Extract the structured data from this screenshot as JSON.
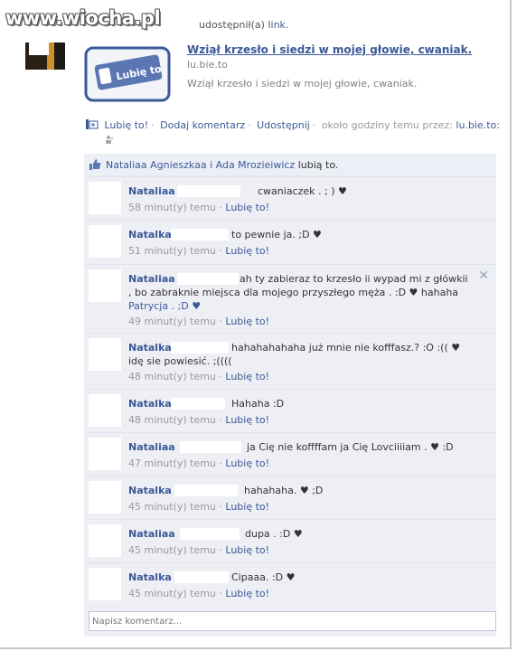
{
  "watermark": "www.wiocha.pl",
  "post": {
    "shared_text": "udostępnił(a)",
    "shared_link": "link.",
    "link_title": "Wziął krzesło i siedzi w mojej głowie, cwaniak.",
    "link_domain": "lu.bie.to",
    "link_description": "Wziął krzesło i siedzi w mojej głowie, cwaniak.",
    "thumb_text": "Lubię to"
  },
  "actions": {
    "like": "Lubię to!",
    "comment": "Dodaj komentarz",
    "share": "Udostępnij",
    "time": "około godziny temu przez:",
    "via": "lu.bie.to:"
  },
  "likes": {
    "names": "Nataliaa Agnieszkaa i Ada Mrozieiwicz",
    "suffix": "lubią to."
  },
  "comments": [
    {
      "author": "Nataliaa",
      "text": "cwaniaczek . ; ) ♥",
      "time": "58 minut(y) temu",
      "like": "Lubię to!"
    },
    {
      "author": "Natalka",
      "text": "to pewnie ja. ;D ♥",
      "time": "51 minut(y) temu",
      "like": "Lubię to!"
    },
    {
      "author": "Nataliaa",
      "text": "ah ty zabieraz to krzesło ii wypad mi z główkii",
      "text2": ", bo zabraknie miejsca dla mojego przyszłego męża . :D ♥ hahaha",
      "text3": "Patrycja . ;D ♥",
      "time": "49 minut(y) temu",
      "like": "Lubię to!"
    },
    {
      "author": "Natalka",
      "text": "hahahahahaha już mnie nie kofffasz.? :O :(( ♥",
      "text2": "idę sie powiesić. ;((((",
      "time": "48 minut(y) temu",
      "like": "Lubię to!"
    },
    {
      "author": "Natalka",
      "text": "Hahaha :D",
      "time": "48 minut(y) temu",
      "like": "Lubię to!"
    },
    {
      "author": "Nataliaa",
      "text": "ja Cię nie koffffam ja Cię Lovciiiiam . ♥ :D",
      "time": "47 minut(y) temu",
      "like": "Lubię to!"
    },
    {
      "author": "Natalka",
      "text": "hahahaha. ♥ ;D",
      "time": "45 minut(y) temu",
      "like": "Lubię to!"
    },
    {
      "author": "Nataliaa",
      "text": "dupa . :D ♥",
      "time": "45 minut(y) temu",
      "like": "Lubię to!"
    },
    {
      "author": "Natalka",
      "text": "Cipaaa. :D ♥",
      "time": "45 minut(y) temu",
      "like": "Lubię to!"
    }
  ],
  "write_comment": {
    "placeholder": "Napisz komentarz..."
  },
  "colors": {
    "link": "#3b5998",
    "comment_bg": "#edeff4",
    "likes_bg": "#eceff5"
  }
}
